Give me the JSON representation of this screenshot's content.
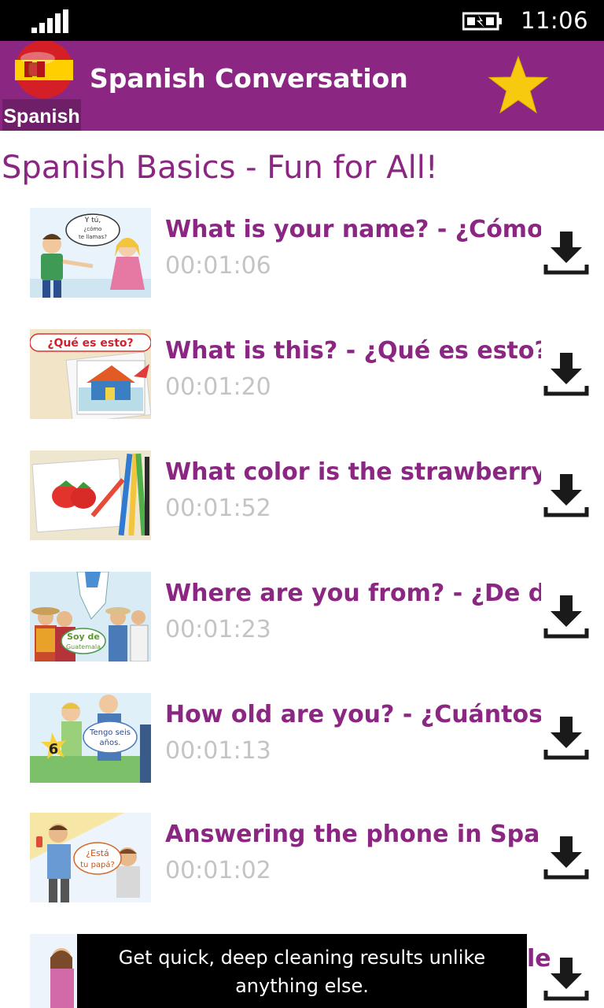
{
  "status_bar": {
    "time": "11:06"
  },
  "header": {
    "title": "Spanish Conversation",
    "logo_label": "Spanish"
  },
  "section": {
    "title": "Spanish Basics - Fun for All!"
  },
  "videos": [
    {
      "title": "What is your name? - ¿Cómo te",
      "duration": "00:01:06"
    },
    {
      "title": "What is this? - ¿Qué es esto? b",
      "duration": "00:01:20"
    },
    {
      "title": "What color is the strawberry? -",
      "duration": "00:01:52"
    },
    {
      "title": "Where are you from? - ¿De dón",
      "duration": "00:01:23"
    },
    {
      "title": "How old are you? - ¿Cuántos a",
      "duration": "00:01:13"
    },
    {
      "title": "Answering the phone in Spanis",
      "duration": "00:01:02"
    },
    {
      "title": "le",
      "duration": ""
    }
  ],
  "thumbnails": {
    "t0": {
      "bubble1": "Y tú,",
      "bubble2": "¿cómo",
      "bubble3": "te llamas?"
    },
    "t1": {
      "banner": "¿Qué es esto?"
    },
    "t3": {
      "bubble1": "Soy de",
      "bubble2": "Guatemala"
    },
    "t4": {
      "bubble1": "Tengo seis",
      "bubble2": "años.",
      "number": "6"
    },
    "t5": {
      "bubble1": "¿Está",
      "bubble2": "tu papá?"
    }
  },
  "toast": {
    "line1": "Get quick, deep cleaning results unlike",
    "line2": "anything else."
  },
  "colors": {
    "header": "#8b2783",
    "accent": "#8b2783",
    "duration": "#c4c4c4",
    "star": "#f7c90f"
  },
  "icons": {
    "download": "download-icon",
    "favorite": "star-icon",
    "signal": "signal-icon",
    "battery": "battery-charging-icon"
  }
}
